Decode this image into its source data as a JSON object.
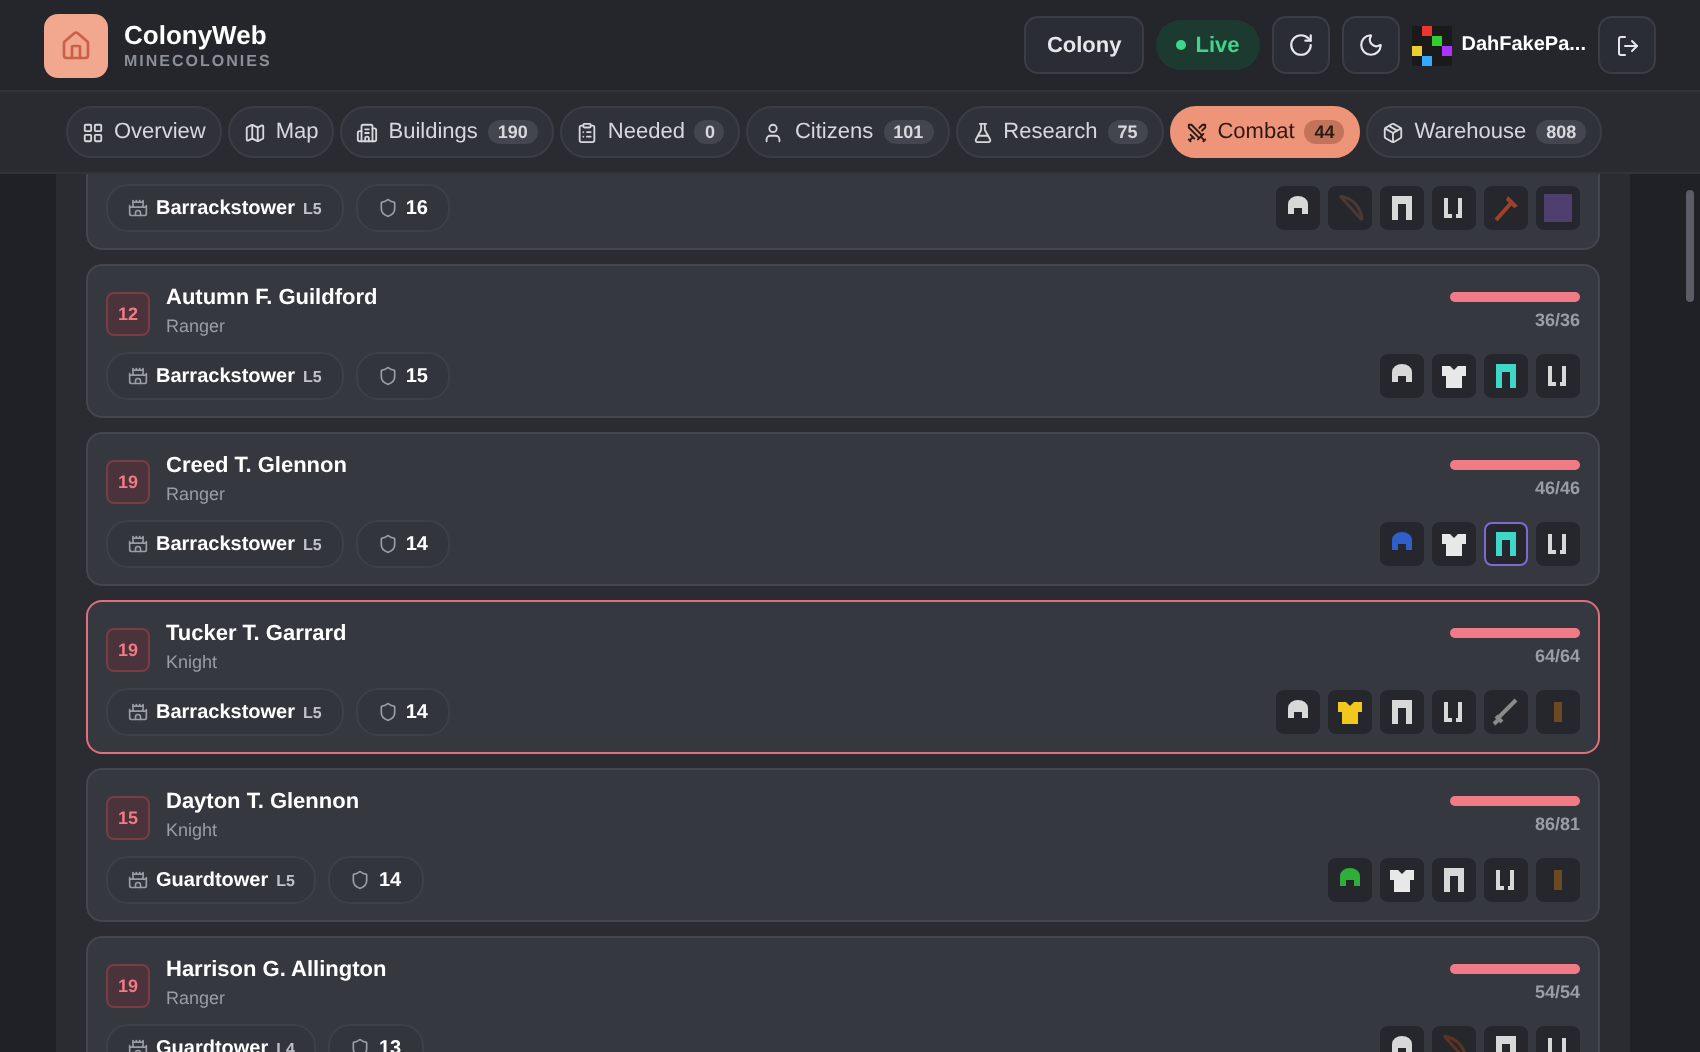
{
  "header": {
    "title": "ColonyWeb",
    "subtitle": "MINECOLONIES",
    "colony_button": "Colony",
    "status": {
      "label": "Live",
      "on": true
    },
    "user": {
      "name": "DahFakePa..."
    }
  },
  "tabs": [
    {
      "kind": "overview",
      "label": "Overview",
      "selected": false
    },
    {
      "kind": "map",
      "label": "Map",
      "selected": false
    },
    {
      "kind": "buildings",
      "label": "Buildings",
      "count": "190",
      "selected": false
    },
    {
      "kind": "needed",
      "label": "Needed",
      "count": "0",
      "selected": false
    },
    {
      "kind": "citizens",
      "label": "Citizens",
      "count": "101",
      "selected": false
    },
    {
      "kind": "research",
      "label": "Research",
      "count": "75",
      "selected": false
    },
    {
      "kind": "combat",
      "label": "Combat",
      "count": "44",
      "selected": true
    },
    {
      "kind": "warehouse",
      "label": "Warehouse",
      "count": "808",
      "selected": false
    }
  ],
  "guards": [
    {
      "selected": false,
      "building": "Barrackstower",
      "building_level": "L5",
      "armor": "16",
      "equipment": [
        {
          "kind": "helmet",
          "color": "#d8d8d8",
          "selected": false
        },
        {
          "kind": "bow",
          "color": "#4a3a34",
          "selected": false
        },
        {
          "kind": "leggings",
          "color": "#d8d8d8",
          "selected": false
        },
        {
          "kind": "boots",
          "color": "#d8d8d8",
          "selected": false
        },
        {
          "kind": "axe",
          "color": "#a0402a",
          "selected": false
        },
        {
          "kind": "block",
          "color": "#4e3f6e",
          "selected": false
        }
      ]
    },
    {
      "selected": false,
      "rank": "12",
      "name": "Autumn F. Guildford",
      "role": "Ranger",
      "health": {
        "level": 1,
        "reading": "36/36"
      },
      "building": "Barrackstower",
      "building_level": "L5",
      "armor": "15",
      "equipment": [
        {
          "kind": "helmet",
          "color": "#d8d8d8",
          "selected": false
        },
        {
          "kind": "chestplate",
          "color": "#e8e8e8",
          "selected": false
        },
        {
          "kind": "leggings",
          "color": "#3fd8c8",
          "selected": false
        },
        {
          "kind": "boots",
          "color": "#d8d8d8",
          "selected": false
        }
      ]
    },
    {
      "selected": false,
      "rank": "19",
      "name": "Creed T. Glennon",
      "role": "Ranger",
      "health": {
        "level": 1,
        "reading": "46/46"
      },
      "building": "Barrackstower",
      "building_level": "L5",
      "armor": "14",
      "equipment": [
        {
          "kind": "helmet",
          "color": "#2f5fc8",
          "selected": false
        },
        {
          "kind": "chestplate",
          "color": "#e8e8e8",
          "selected": false
        },
        {
          "kind": "leggings",
          "color": "#3fd8c8",
          "selected": true
        },
        {
          "kind": "boots",
          "color": "#d8d8d8",
          "selected": false
        }
      ]
    },
    {
      "selected": true,
      "rank": "19",
      "name": "Tucker T. Garrard",
      "role": "Knight",
      "health": {
        "level": 1,
        "reading": "64/64"
      },
      "building": "Barrackstower",
      "building_level": "L5",
      "armor": "14",
      "equipment": [
        {
          "kind": "helmet",
          "color": "#d8d8d8",
          "selected": false
        },
        {
          "kind": "chestplate",
          "color": "#f2c81e",
          "selected": false
        },
        {
          "kind": "leggings",
          "color": "#d8d8d8",
          "selected": false
        },
        {
          "kind": "boots",
          "color": "#d8d8d8",
          "selected": false
        },
        {
          "kind": "sword",
          "color": "#8a8a8a",
          "selected": false
        },
        {
          "kind": "shield",
          "color": "#6b4a22",
          "selected": false
        }
      ]
    },
    {
      "selected": false,
      "rank": "15",
      "name": "Dayton T. Glennon",
      "role": "Knight",
      "health": {
        "level": 1,
        "reading": "86/81"
      },
      "building": "Guardtower",
      "building_level": "L5",
      "armor": "14",
      "equipment": [
        {
          "kind": "helmet",
          "color": "#2fae3a",
          "selected": false
        },
        {
          "kind": "chestplate",
          "color": "#e8e8e8",
          "selected": false
        },
        {
          "kind": "leggings",
          "color": "#d8d8d8",
          "selected": false
        },
        {
          "kind": "boots",
          "color": "#d8d8d8",
          "selected": false
        },
        {
          "kind": "shield",
          "color": "#6b4a22",
          "selected": false
        }
      ]
    },
    {
      "selected": false,
      "rank": "19",
      "name": "Harrison G. Allington",
      "role": "Ranger",
      "health": {
        "level": 1,
        "reading": "54/54"
      },
      "building": "Guardtower",
      "building_level": "L4",
      "armor": "13",
      "equipment": [
        {
          "kind": "helmet",
          "color": "#d8d8d8",
          "selected": false
        },
        {
          "kind": "bow",
          "color": "#5a3420",
          "selected": false
        },
        {
          "kind": "leggings",
          "color": "#d8d8d8",
          "selected": false
        },
        {
          "kind": "boots",
          "color": "#d8d8d8",
          "selected": false
        }
      ]
    }
  ]
}
